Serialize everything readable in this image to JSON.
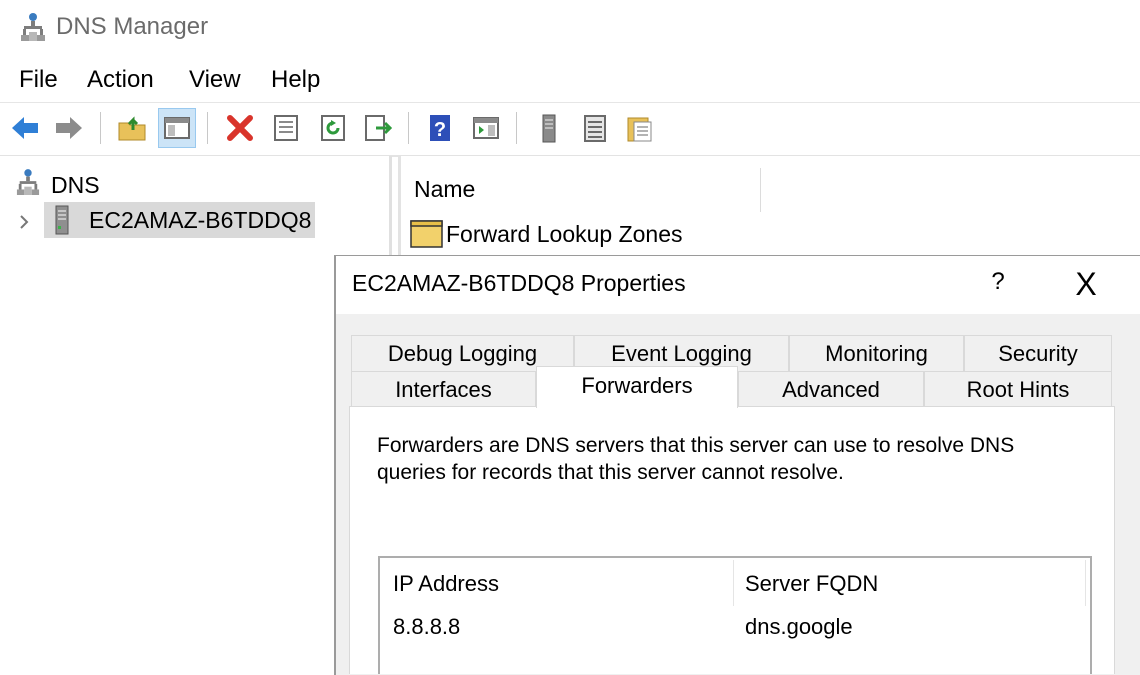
{
  "window": {
    "title": "DNS Manager"
  },
  "menu": [
    "File",
    "Action",
    "View",
    "Help"
  ],
  "toolbar": {
    "buttons": [
      "back-icon",
      "forward-icon",
      "up-folder-icon",
      "show-hide-tree-icon",
      "delete-icon",
      "properties-icon",
      "refresh-icon",
      "export-list-icon",
      "help-icon",
      "show-action-pane-icon",
      "server-icon",
      "list-icon",
      "clipboard-icon"
    ]
  },
  "tree": {
    "root_label": "DNS",
    "server_label": "EC2AMAZ-B6TDDQ8"
  },
  "list": {
    "column_name": "Name",
    "items": [
      "Forward Lookup Zones"
    ]
  },
  "dialog": {
    "title": "EC2AMAZ-B6TDDQ8 Properties",
    "help_label": "?",
    "close_label": "X",
    "tabs_row1": [
      "Debug Logging",
      "Event Logging",
      "Monitoring",
      "Security"
    ],
    "tabs_row2": [
      "Interfaces",
      "Forwarders",
      "Advanced",
      "Root Hints"
    ],
    "active_tab": "Forwarders",
    "description_line1": "Forwarders are DNS servers that this server can use to resolve DNS",
    "description_line2": "queries for records that this server cannot resolve.",
    "forwarders": {
      "columns": [
        "IP Address",
        "Server FQDN"
      ],
      "rows": [
        {
          "ip": "8.8.8.8",
          "fqdn": "dns.google"
        }
      ]
    }
  },
  "colors": {
    "selection": "#d9d9d9",
    "dialog_bg": "#f0f0f0",
    "delete_red": "#d9342b",
    "arrow_blue": "#2f7fd6"
  }
}
